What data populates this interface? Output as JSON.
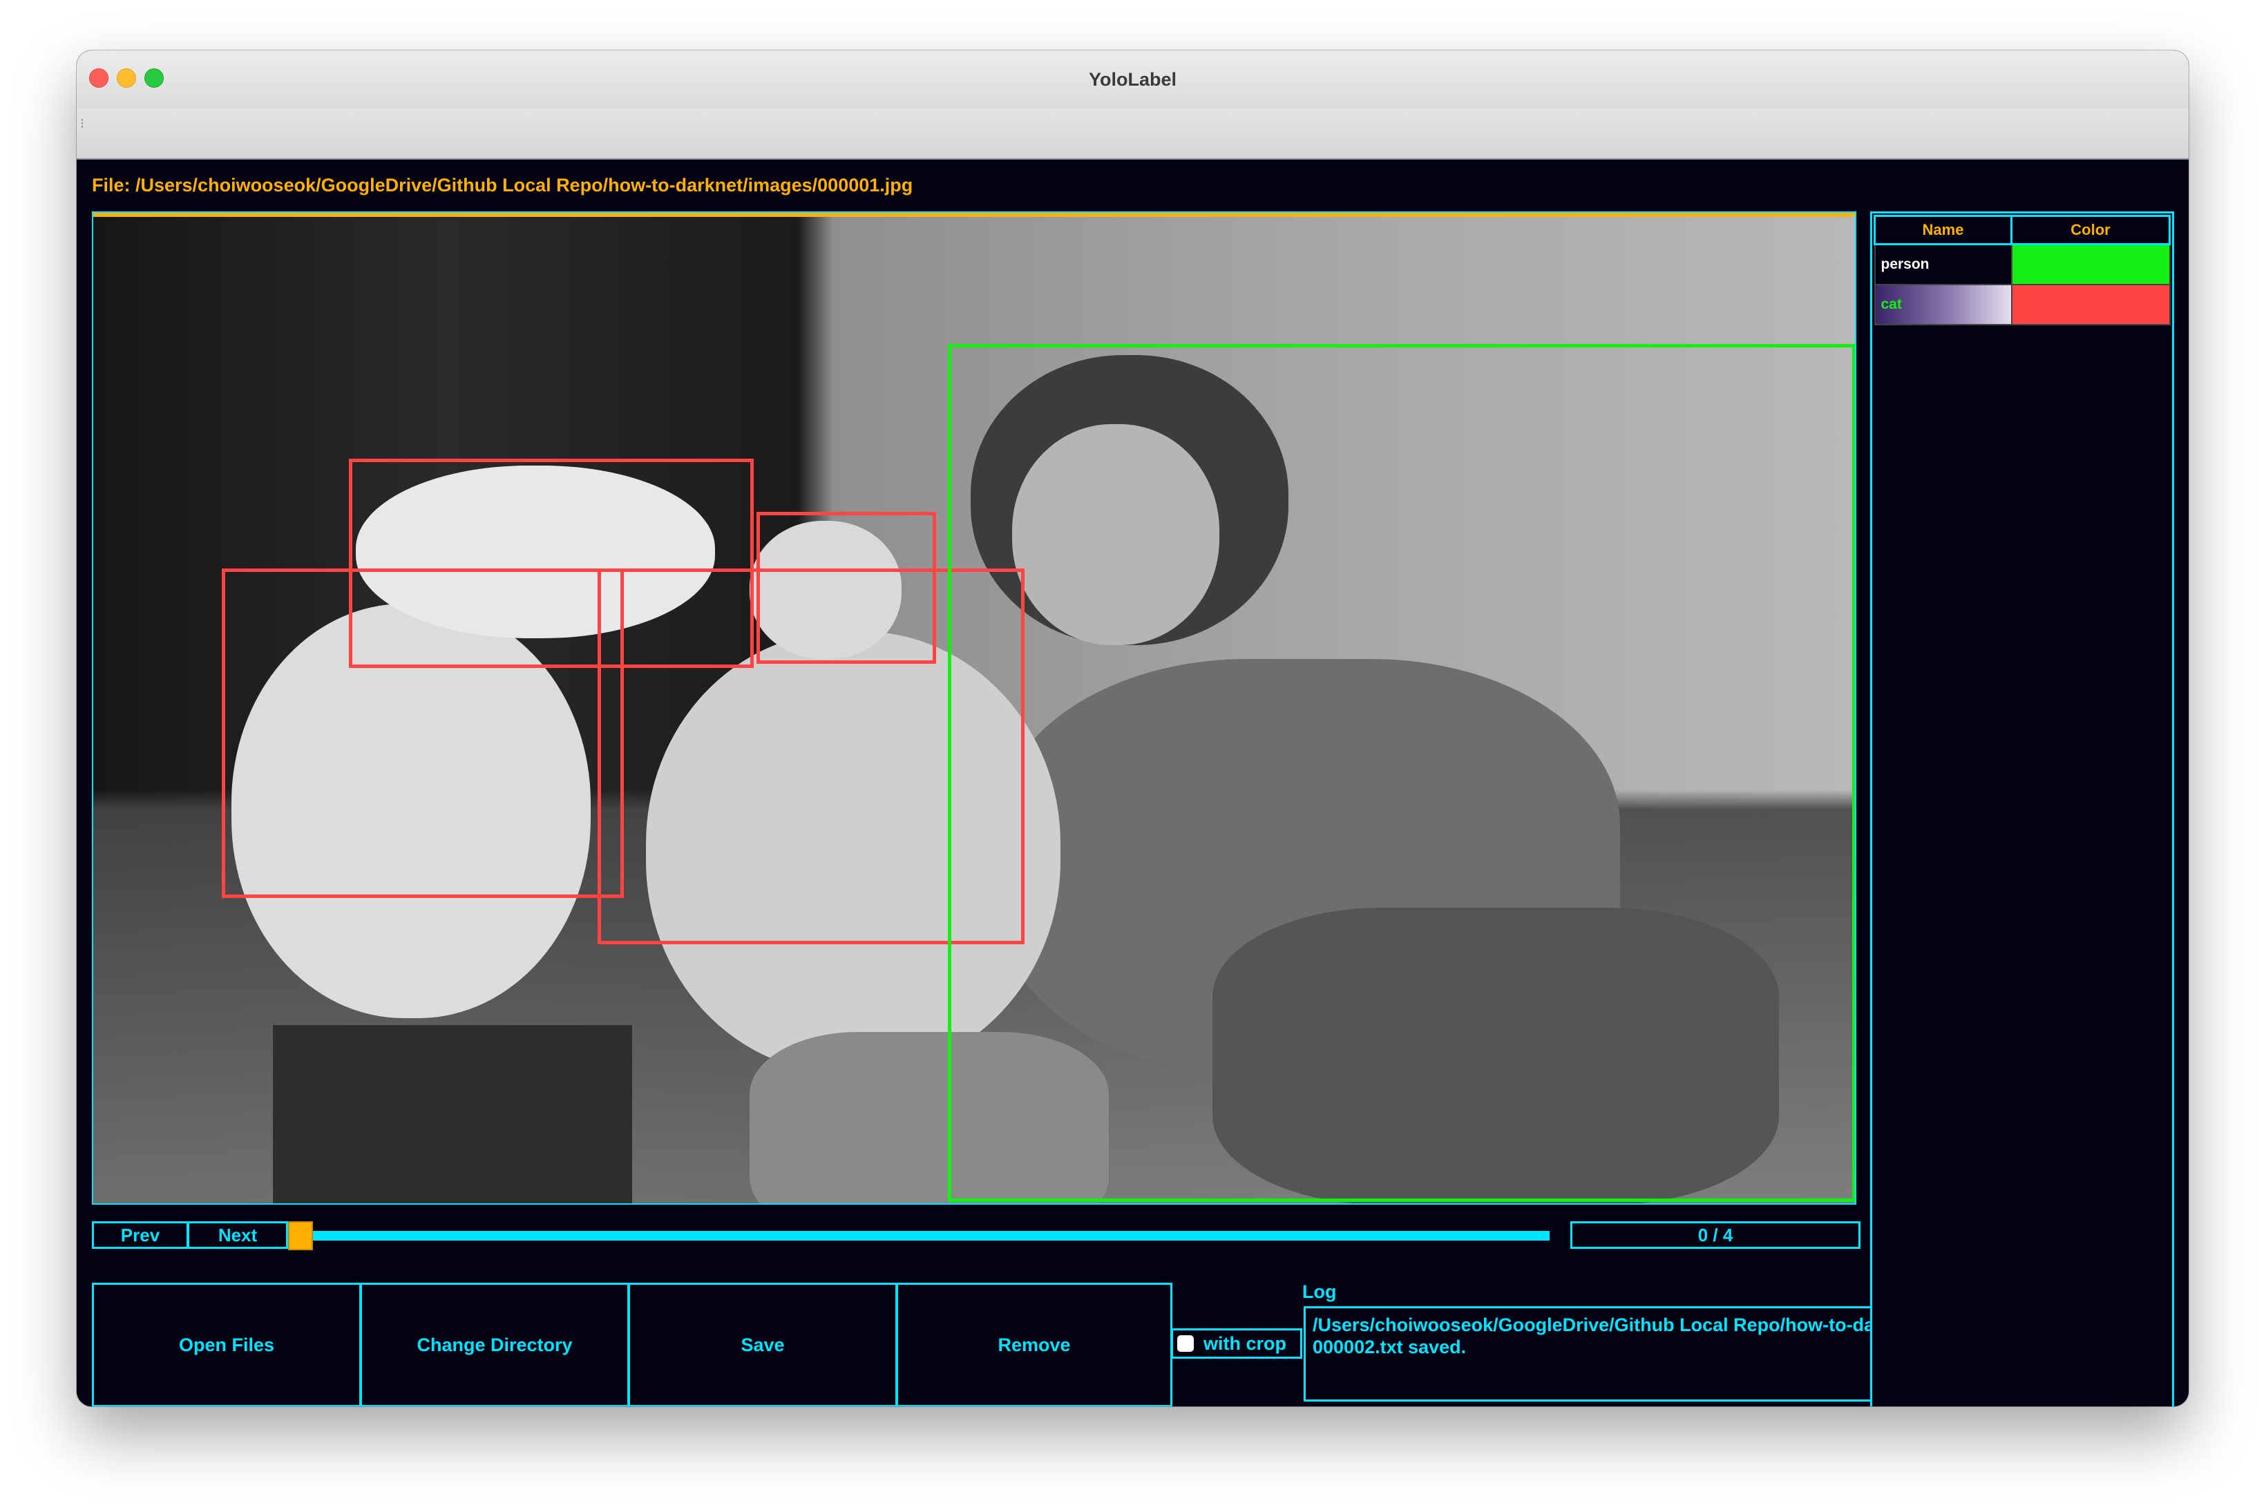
{
  "window": {
    "title": "YoloLabel"
  },
  "file": {
    "label": "File: /Users/choiwooseok/GoogleDrive/Github Local Repo/how-to-darknet/images/000001.jpg"
  },
  "navigation": {
    "prev_label": "Prev",
    "next_label": "Next",
    "counter": "0 / 4",
    "progress": 0
  },
  "actions": {
    "open_files": "Open Files",
    "change_directory": "Change Directory",
    "save": "Save",
    "remove": "Remove",
    "with_crop": "with crop",
    "with_crop_checked": false
  },
  "log": {
    "label": "Log",
    "lines": [
      "/Users/choiwooseok/GoogleDrive/Github Local Repo/how-to-darknet/images/",
      "000002.txt saved."
    ]
  },
  "classes": {
    "headers": {
      "name": "Name",
      "color": "Color"
    },
    "items": [
      {
        "name": "person",
        "color": "#14f014"
      },
      {
        "name": "cat",
        "color": "#ff4444"
      }
    ],
    "selected": "cat"
  },
  "annotations": [
    {
      "class": "cat"
    },
    {
      "class": "cat"
    },
    {
      "class": "cat"
    },
    {
      "class": "cat"
    },
    {
      "class": "person"
    }
  ],
  "colors": {
    "accent": "#00e5ff",
    "highlight": "#ffb000",
    "background": "#020212"
  }
}
